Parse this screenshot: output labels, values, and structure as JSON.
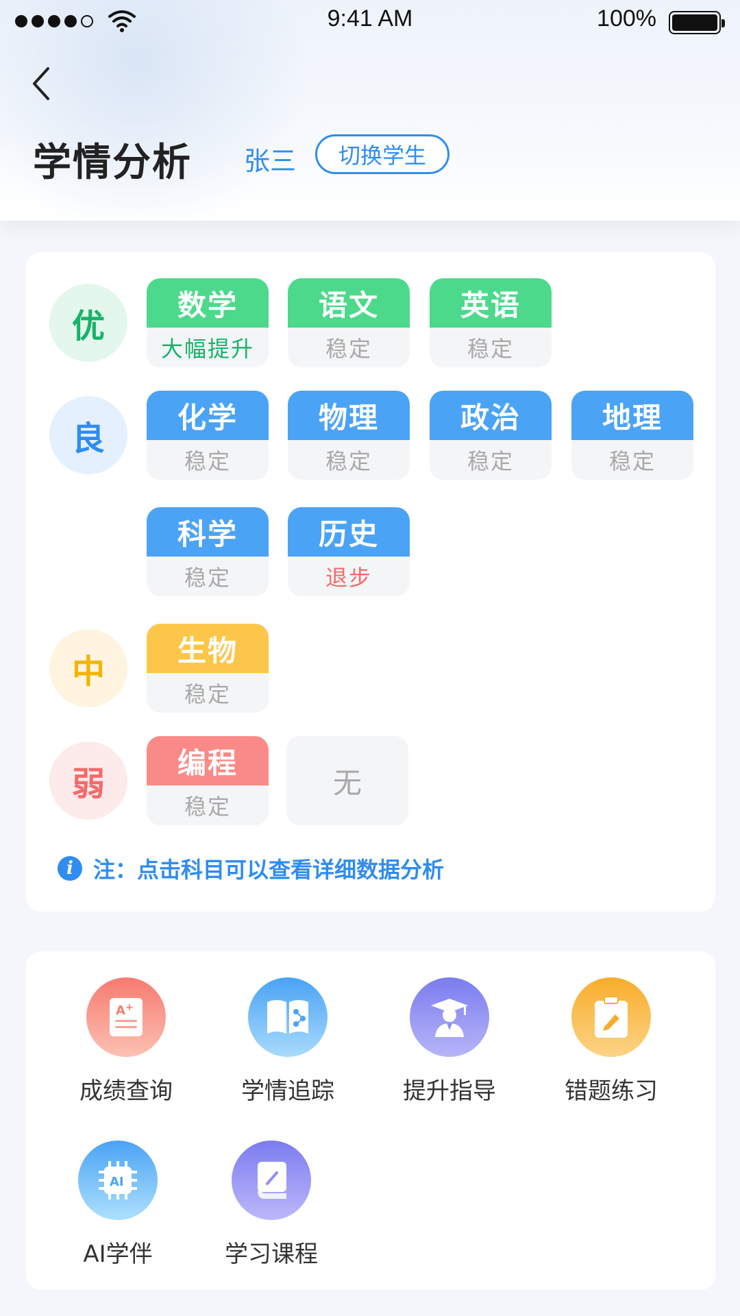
{
  "status_bar": {
    "time": "9:41 AM",
    "battery": "100%"
  },
  "header": {
    "title": "学情分析",
    "student_name": "张三",
    "switch_label": "切换学生"
  },
  "levels": [
    {
      "label": "优",
      "color": "#17b36a",
      "bg": "#e3f7ec"
    },
    {
      "label": "良",
      "color": "#2f8cf0",
      "bg": "#e4f0fd"
    },
    {
      "label": "中",
      "color": "#f5b400",
      "bg": "#fff4e0"
    },
    {
      "label": "弱",
      "color": "#f46a6a",
      "bg": "#fdeaea"
    }
  ],
  "subjects": [
    {
      "name": "数学",
      "status": "大幅提升",
      "header_color": "#4cd98b",
      "status_color": "#17b36a"
    },
    {
      "name": "语文",
      "status": "稳定",
      "header_color": "#4cd98b",
      "status_color": "#a9a9a9"
    },
    {
      "name": "英语",
      "status": "稳定",
      "header_color": "#4cd98b",
      "status_color": "#a9a9a9"
    },
    {
      "name": "化学",
      "status": "稳定",
      "header_color": "#4aa3f5",
      "status_color": "#a9a9a9"
    },
    {
      "name": "物理",
      "status": "稳定",
      "header_color": "#4aa3f5",
      "status_color": "#a9a9a9"
    },
    {
      "name": "政治",
      "status": "稳定",
      "header_color": "#4aa3f5",
      "status_color": "#a9a9a9"
    },
    {
      "name": "地理",
      "status": "稳定",
      "header_color": "#4aa3f5",
      "status_color": "#a9a9a9"
    },
    {
      "name": "科学",
      "status": "稳定",
      "header_color": "#4aa3f5",
      "status_color": "#a9a9a9"
    },
    {
      "name": "历史",
      "status": "退步",
      "header_color": "#4aa3f5",
      "status_color": "#f46a6a"
    },
    {
      "name": "生物",
      "status": "稳定",
      "header_color": "#fbc64a",
      "status_color": "#a9a9a9"
    },
    {
      "name": "编程",
      "status": "稳定",
      "header_color": "#f98a87",
      "status_color": "#a9a9a9"
    }
  ],
  "none_label": "无",
  "note": "注：点击科目可以查看详细数据分析",
  "tools": [
    {
      "label": "成绩查询",
      "icon": "report-card-icon"
    },
    {
      "label": "学情追踪",
      "icon": "open-book-icon"
    },
    {
      "label": "提升指导",
      "icon": "graduate-icon"
    },
    {
      "label": "错题练习",
      "icon": "clipboard-edit-icon"
    },
    {
      "label": "AI学伴",
      "icon": "ai-chip-icon"
    },
    {
      "label": "学习课程",
      "icon": "book-icon"
    }
  ]
}
